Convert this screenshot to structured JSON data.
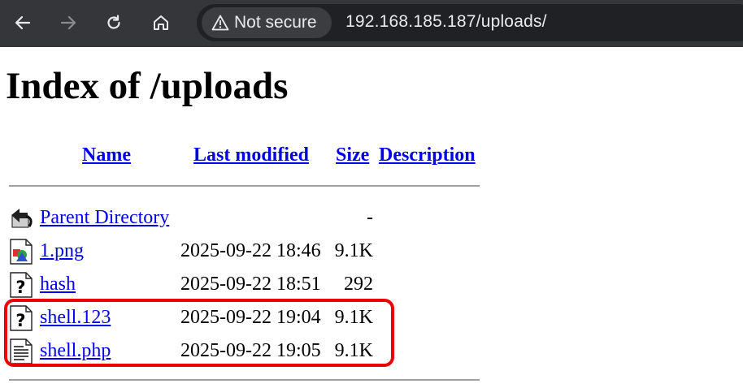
{
  "browser": {
    "security_label": "Not secure",
    "url": "192.168.185.187/uploads/"
  },
  "page": {
    "title": "Index of /uploads",
    "columns": {
      "name": "Name",
      "last_modified": "Last modified",
      "size": "Size",
      "description": "Description"
    },
    "entries": [
      {
        "name": "Parent Directory",
        "modified": "",
        "size": "-",
        "icon": "parent-directory-icon"
      },
      {
        "name": "1.png",
        "modified": "2025-09-22 18:46",
        "size": "9.1K",
        "icon": "image-file-icon"
      },
      {
        "name": "hash",
        "modified": "2025-09-22 18:51",
        "size": "292",
        "icon": "unknown-file-icon"
      },
      {
        "name": "shell.123",
        "modified": "2025-09-22 19:04",
        "size": "9.1K",
        "icon": "unknown-file-icon"
      },
      {
        "name": "shell.php",
        "modified": "2025-09-22 19:05",
        "size": "9.1K",
        "icon": "text-file-icon"
      }
    ]
  },
  "annotation": {
    "highlight_color": "#ee0000"
  }
}
